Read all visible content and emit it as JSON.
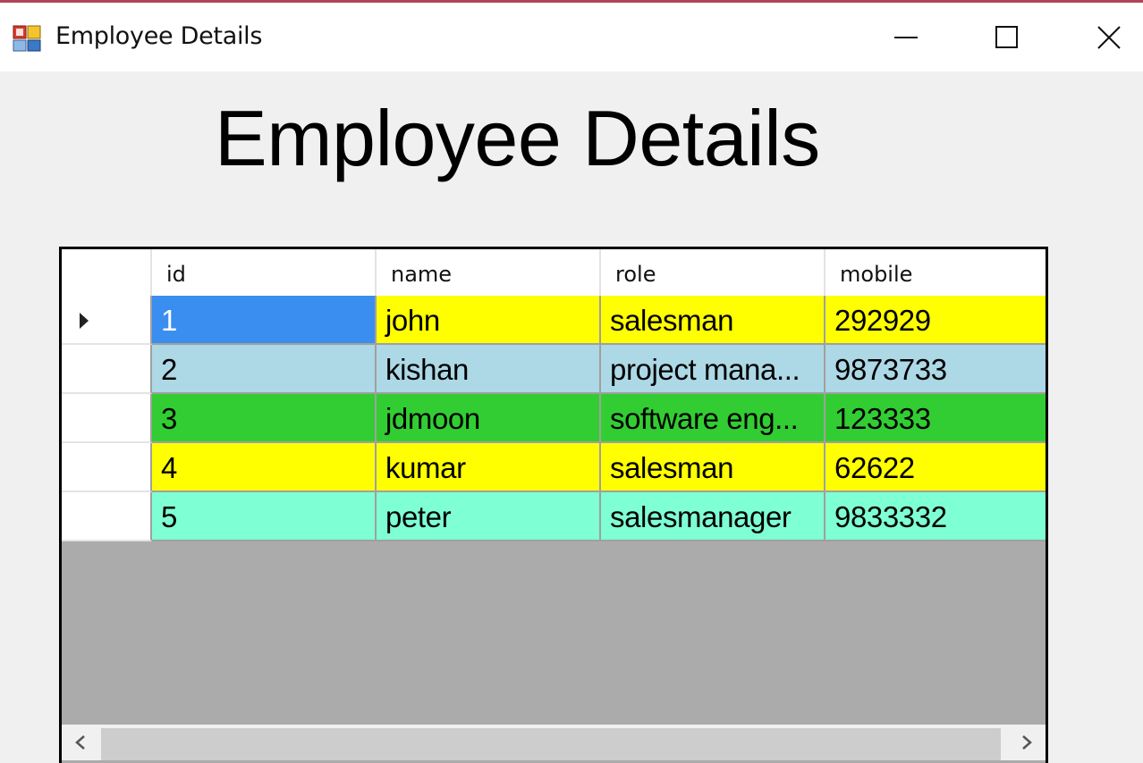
{
  "window": {
    "title": "Employee Details",
    "icon": "winforms-app-icon",
    "controls": [
      "minimize-icon",
      "maximize-icon",
      "close-icon"
    ]
  },
  "form": {
    "heading": "Employee Details"
  },
  "grid": {
    "columns": [
      "id",
      "name",
      "role",
      "mobile"
    ],
    "rows": [
      {
        "id": "1",
        "name": "john",
        "role": "salesman",
        "mobile": "292929",
        "color": "#ffff00",
        "current": true
      },
      {
        "id": "2",
        "name": "kishan",
        "role": "project mana...",
        "mobile": "9873733",
        "color": "#add8e6",
        "current": false
      },
      {
        "id": "3",
        "name": "jdmoon",
        "role": "software eng...",
        "mobile": "123333",
        "color": "#32cd32",
        "current": false
      },
      {
        "id": "4",
        "name": "kumar",
        "role": "salesman",
        "mobile": "62622",
        "color": "#ffff00",
        "current": false
      },
      {
        "id": "5",
        "name": "peter",
        "role": "salesmanager",
        "mobile": "9833332",
        "color": "#7fffd4",
        "current": false
      }
    ],
    "selected_cell_color": "#3a8ef0",
    "empty_area_color": "#ababab"
  }
}
